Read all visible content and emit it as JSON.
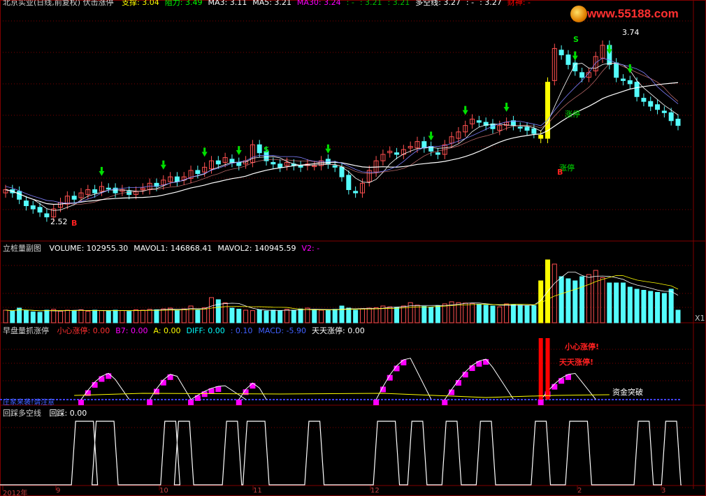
{
  "main_header": {
    "title": "北京实业(日线,前复权) 伏击涨停",
    "items": [
      {
        "text": "支撑: 3.04",
        "color": "#ffff00"
      },
      {
        "text": "阻力: 3.49",
        "color": "#00ff00"
      },
      {
        "text": "MA3: 3.11",
        "color": "#ffffff"
      },
      {
        "text": "MA5: 3.21",
        "color": "#ffffff"
      },
      {
        "text": "MA30: 3.24",
        "color": "#ff00ff"
      },
      {
        "text": ": -",
        "color": "#00c000"
      },
      {
        "text": ": 3.21",
        "color": "#00c000"
      },
      {
        "text": ": 3.21",
        "color": "#00c000"
      },
      {
        "text": "多空线: 3.27",
        "color": "#ffffff"
      },
      {
        "text": ": -",
        "color": "#ffffff"
      },
      {
        "text": ": 3.27",
        "color": "#ffffff"
      },
      {
        "text": "财神: -",
        "color": "#ff0000"
      }
    ]
  },
  "logo": {
    "text": "www.55188.com"
  },
  "volume_header": {
    "title": "立桩量副图",
    "items": [
      {
        "text": "VOLUME: 102955.30",
        "color": "#ffffff"
      },
      {
        "text": "MAVOL1: 146868.41",
        "color": "#ffffff"
      },
      {
        "text": "MAVOL2: 140945.59",
        "color": "#ffffff"
      },
      {
        "text": "V2: -",
        "color": "#ff00ff"
      }
    ],
    "right_tag": "X1"
  },
  "ind_header": {
    "title": "早盘量抓涨停",
    "items": [
      {
        "text": "小心涨停: 0.00",
        "color": "#ff3030"
      },
      {
        "text": "B7: 0.00",
        "color": "#ff00ff"
      },
      {
        "text": "A: 0.00",
        "color": "#ffff00"
      },
      {
        "text": "DIFF: 0.00",
        "color": "#00ffff"
      },
      {
        "text": ": 0.10",
        "color": "#4060ff"
      },
      {
        "text": "MACD: -5.90",
        "color": "#4060ff"
      },
      {
        "text": "天天涨停: 0.00",
        "color": "#ffffff"
      }
    ]
  },
  "ind_annotations": {
    "warn1": "小心涨停!",
    "warn2": "天天涨停!",
    "fund": "资金突破",
    "bottom_left": "庄家来袭!请注意"
  },
  "bottom_header": {
    "title": "回踩多空线",
    "items": [
      {
        "text": "回踩: 0.00",
        "color": "#ffffff"
      }
    ]
  },
  "main_annotations": {
    "low_price": "2.52",
    "high_price": "3.74",
    "limit_up_1": "涨停",
    "limit_up_2": "涨停",
    "buy": "B",
    "sell": "S"
  },
  "xaxis": {
    "labels": [
      "2012年",
      "9",
      "10",
      "11",
      "12",
      "2",
      "3"
    ]
  },
  "colors": {
    "up": "#ff5050",
    "down": "#54fcfc",
    "ma": "#ffffff",
    "limit": "#ffff00",
    "grid": "#800000",
    "magenta": "#ff00ff"
  },
  "chart_data": {
    "type": "candlestick",
    "price_ylim": [
      2.4,
      3.85
    ],
    "close": [
      2.72,
      2.7,
      2.66,
      2.62,
      2.6,
      2.58,
      2.55,
      2.6,
      2.64,
      2.68,
      2.66,
      2.7,
      2.72,
      2.7,
      2.74,
      2.73,
      2.7,
      2.72,
      2.69,
      2.71,
      2.73,
      2.76,
      2.74,
      2.78,
      2.8,
      2.77,
      2.8,
      2.84,
      2.82,
      2.86,
      2.9,
      2.88,
      2.92,
      2.89,
      2.87,
      2.9,
      3.0,
      2.95,
      2.9,
      2.88,
      2.86,
      2.89,
      2.87,
      2.86,
      2.88,
      2.87,
      2.9,
      2.88,
      2.86,
      2.8,
      2.72,
      2.7,
      2.76,
      2.84,
      2.9,
      2.94,
      2.96,
      2.94,
      2.97,
      2.99,
      3.02,
      2.98,
      2.96,
      2.94,
      3.0,
      3.05,
      3.08,
      3.12,
      3.16,
      3.14,
      3.12,
      3.1,
      3.12,
      3.14,
      3.12,
      3.11,
      3.09,
      3.07,
      3.04,
      3.39,
      3.6,
      3.56,
      3.5,
      3.46,
      3.42,
      3.45,
      3.55,
      3.62,
      3.5,
      3.42,
      3.4,
      3.38,
      3.3,
      3.27,
      3.24,
      3.22,
      3.2,
      3.15,
      3.12
    ],
    "limit_up_bars": [
      78,
      79
    ],
    "volume": [
      60,
      55,
      70,
      58,
      52,
      50,
      60,
      64,
      55,
      60,
      58,
      62,
      55,
      60,
      58,
      56,
      60,
      58,
      54,
      62,
      60,
      64,
      62,
      66,
      70,
      58,
      66,
      80,
      60,
      72,
      120,
      110,
      95,
      70,
      65,
      60,
      58,
      62,
      56,
      60,
      58,
      64,
      60,
      66,
      70,
      62,
      60,
      58,
      64,
      80,
      70,
      60,
      66,
      70,
      72,
      80,
      76,
      74,
      80,
      96,
      84,
      78,
      74,
      82,
      90,
      100,
      96,
      94,
      92,
      88,
      84,
      80,
      76,
      90,
      86,
      84,
      80,
      82,
      200,
      300,
      280,
      220,
      210,
      200,
      220,
      230,
      250,
      215,
      190,
      190,
      190,
      170,
      160,
      155,
      150,
      145,
      140,
      160,
      60
    ]
  }
}
